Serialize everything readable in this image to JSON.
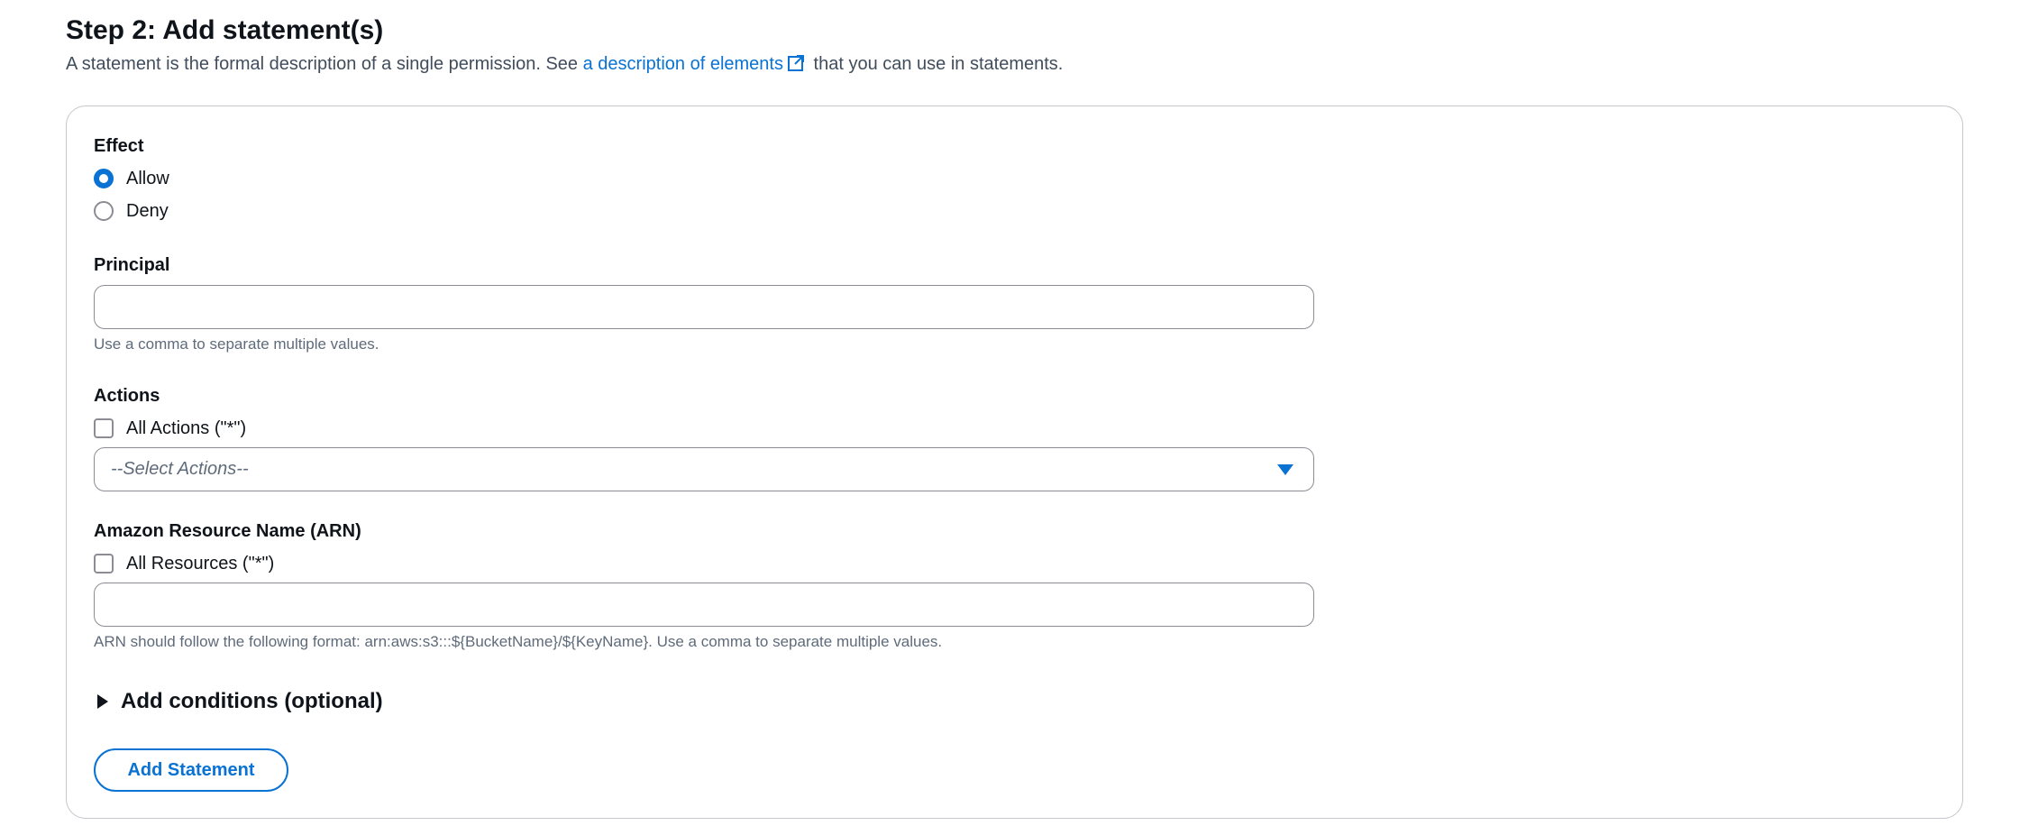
{
  "step": {
    "title": "Step 2: Add statement(s)",
    "description_prefix": "A statement is the formal description of a single permission. See ",
    "description_link": "a description of elements",
    "description_suffix": " that you can use in statements."
  },
  "effect": {
    "label": "Effect",
    "options": [
      {
        "label": "Allow",
        "selected": true
      },
      {
        "label": "Deny",
        "selected": false
      }
    ]
  },
  "principal": {
    "label": "Principal",
    "value": "",
    "hint": "Use a comma to separate multiple values."
  },
  "actions": {
    "label": "Actions",
    "all_label": "All Actions (\"*\")",
    "all_checked": false,
    "select_placeholder": "--Select Actions--"
  },
  "arn": {
    "label": "Amazon Resource Name (ARN)",
    "all_label": "All Resources (\"*\")",
    "all_checked": false,
    "value": "",
    "hint": "ARN should follow the following format: arn:aws:s3:::${BucketName}/${KeyName}. Use a comma to separate multiple values."
  },
  "conditions": {
    "label": "Add conditions (optional)"
  },
  "add_statement_button": "Add Statement",
  "colors": {
    "accent": "#0972d3",
    "text": "#0f141a",
    "muted": "#5f6b7a",
    "border": "#8c8c94"
  }
}
